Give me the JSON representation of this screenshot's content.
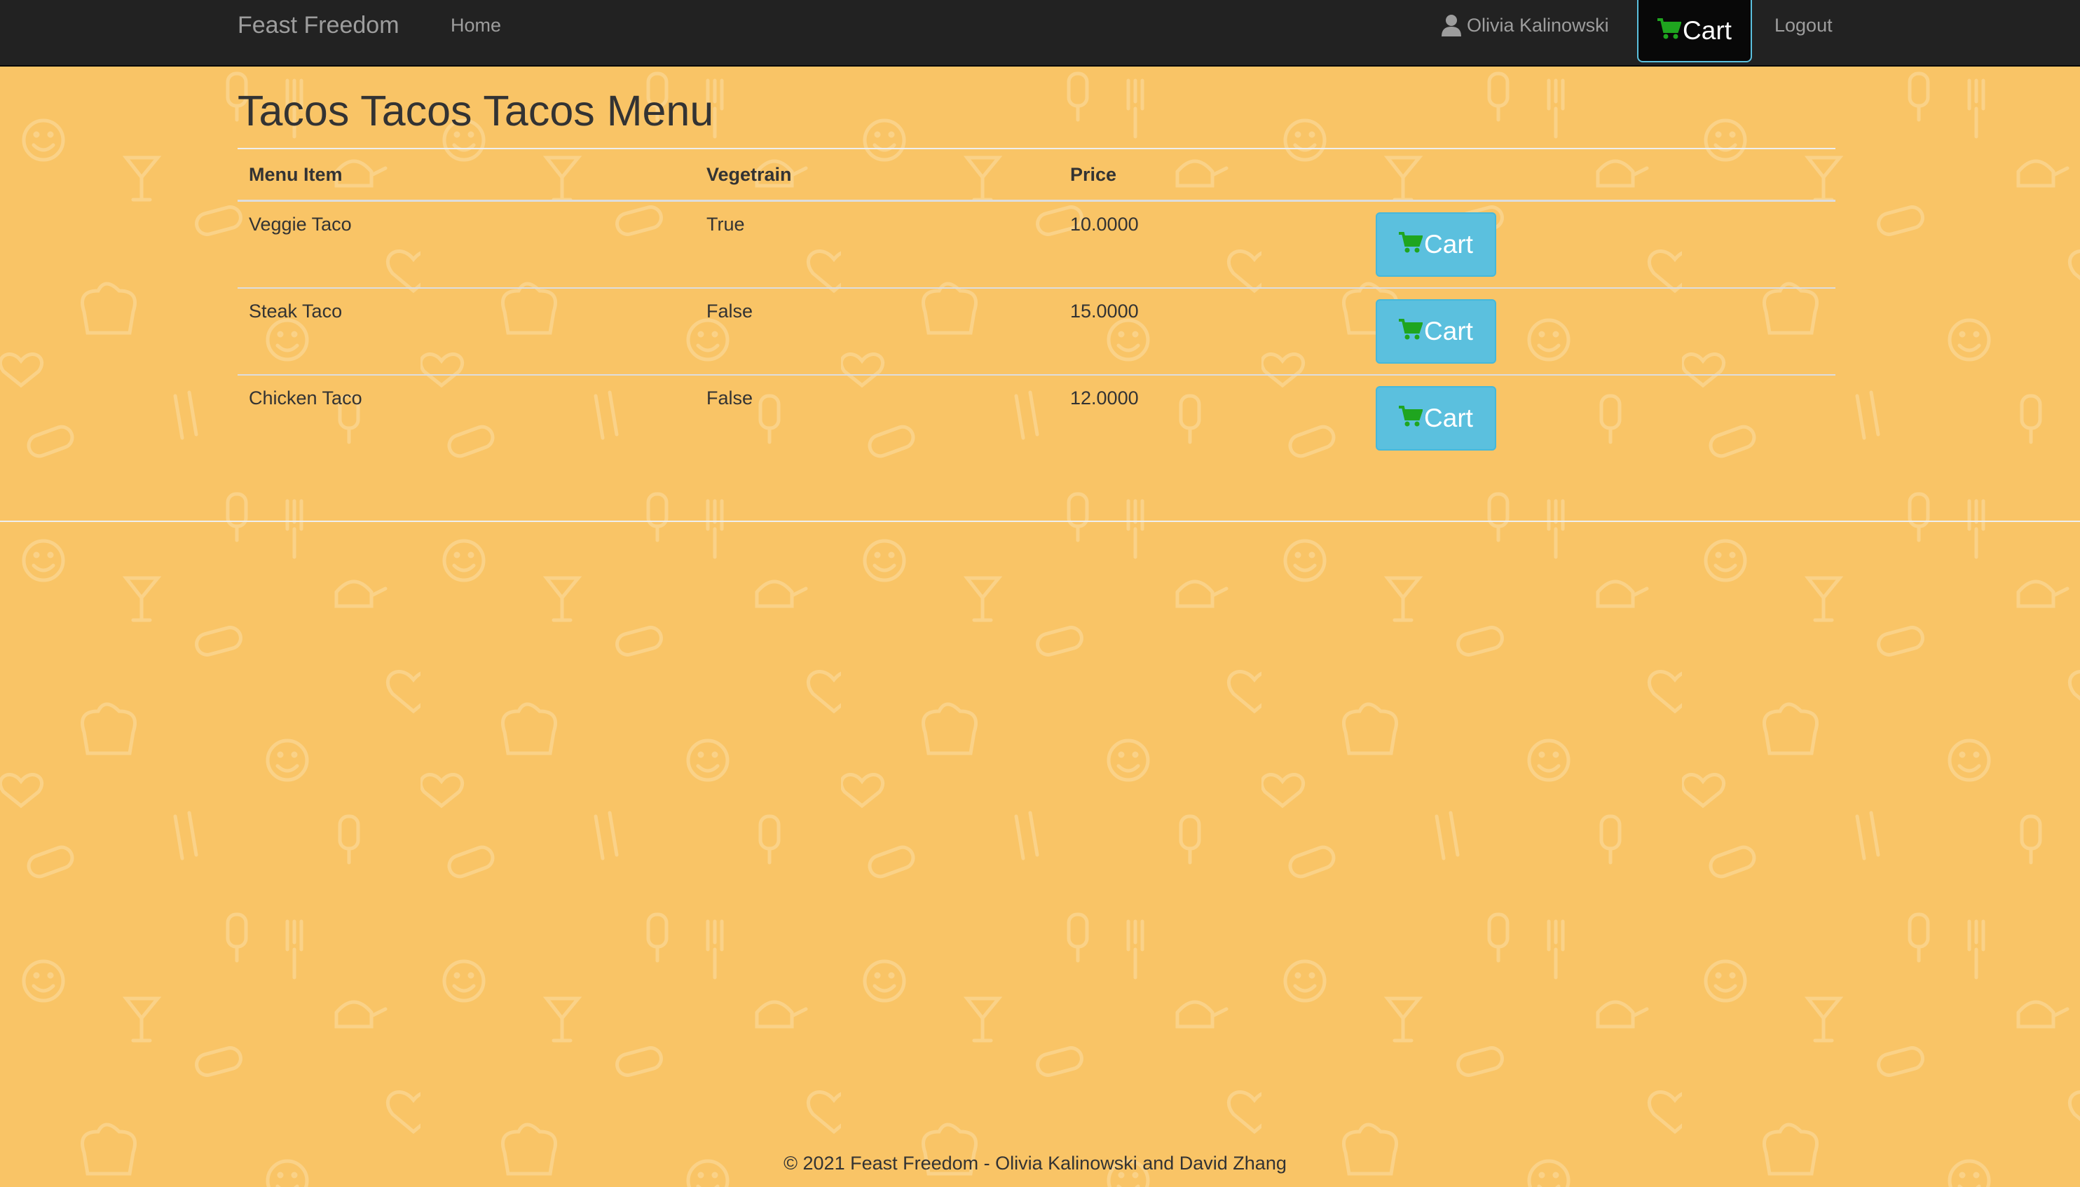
{
  "navbar": {
    "brand": "Feast Freedom",
    "home": "Home",
    "user_name": "Olivia Kalinowski",
    "cart_label": "Cart",
    "logout": "Logout"
  },
  "page": {
    "title": "Tacos Tacos Tacos Menu"
  },
  "table": {
    "headers": [
      "Menu Item",
      "Vegetrain",
      "Price",
      ""
    ],
    "rows": [
      {
        "item": "Veggie Taco",
        "vegetarian": "True",
        "price": "10.0000",
        "button": "Cart"
      },
      {
        "item": "Steak Taco",
        "vegetarian": "False",
        "price": "15.0000",
        "button": "Cart"
      },
      {
        "item": "Chicken Taco",
        "vegetarian": "False",
        "price": "12.0000",
        "button": "Cart"
      }
    ]
  },
  "footer": {
    "text": "© 2021 Feast Freedom - Olivia Kalinowski and David Zhang"
  },
  "colors": {
    "background": "#f9c466",
    "navbar": "#222222",
    "cart_button": "#5bc0de",
    "cart_icon": "#1fa51f"
  }
}
